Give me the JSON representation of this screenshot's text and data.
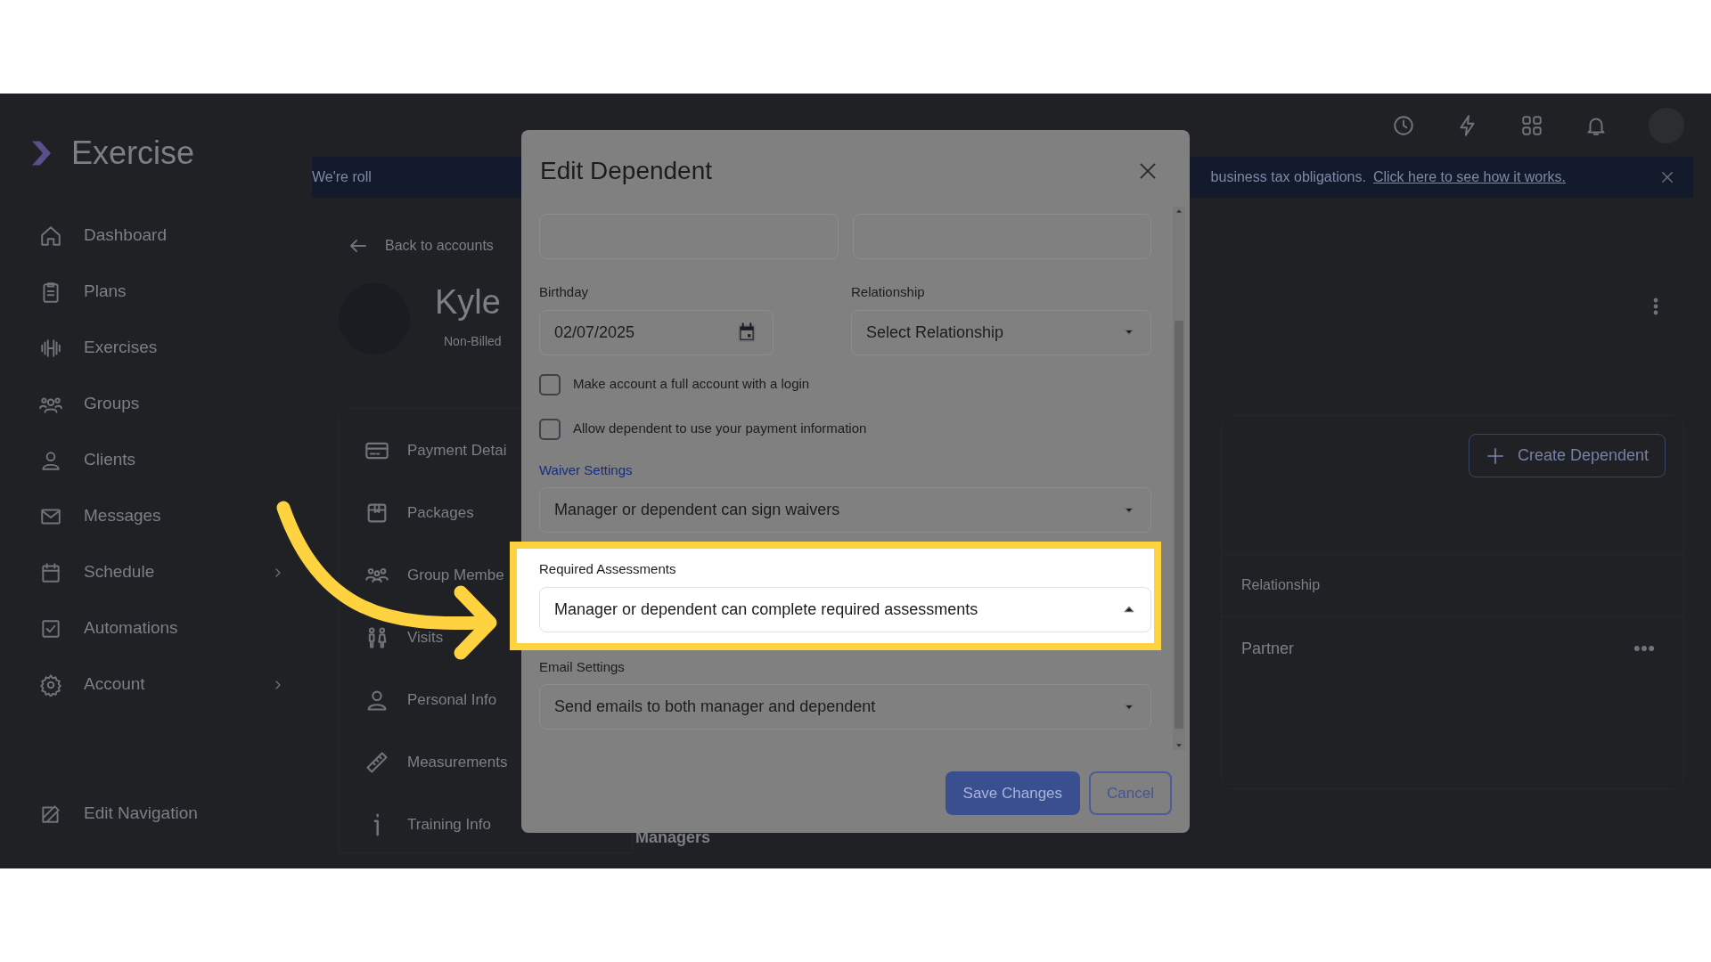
{
  "app": {
    "logo": "Exercise"
  },
  "sidebar": {
    "items": [
      {
        "label": "Dashboard",
        "has_submenu": false
      },
      {
        "label": "Plans",
        "has_submenu": false
      },
      {
        "label": "Exercises",
        "has_submenu": false
      },
      {
        "label": "Groups",
        "has_submenu": false
      },
      {
        "label": "Clients",
        "has_submenu": false
      },
      {
        "label": "Messages",
        "has_submenu": false
      },
      {
        "label": "Schedule",
        "has_submenu": true
      },
      {
        "label": "Automations",
        "has_submenu": false
      },
      {
        "label": "Account",
        "has_submenu": true
      }
    ],
    "footer": {
      "label": "Edit Navigation"
    }
  },
  "banner": {
    "text_left": "We're roll",
    "text_right": "business tax obligations.",
    "link": "Click here to see how it works."
  },
  "profile": {
    "back": "Back to accounts",
    "name": "Kyle",
    "badge": "Non-Billed"
  },
  "profile_menu": [
    {
      "label": "Payment Detai"
    },
    {
      "label": "Packages"
    },
    {
      "label": "Group Membe"
    },
    {
      "label": "Visits"
    },
    {
      "label": "Personal Info"
    },
    {
      "label": "Measurements"
    },
    {
      "label": "Training Info"
    }
  ],
  "dependents": {
    "create_button": "Create Dependent",
    "columns": [
      "Relationship"
    ],
    "rows": [
      [
        "Partner"
      ]
    ],
    "section": "Managers"
  },
  "modal": {
    "title": "Edit Dependent",
    "name_fields": [
      {
        "kind": "text"
      },
      {
        "kind": "text"
      }
    ],
    "birthday": {
      "label": "Birthday",
      "value": "02/07/2025"
    },
    "relationship": {
      "label": "Relationship",
      "value": "Select Relationship",
      "expanded": false
    },
    "checkboxes": [
      {
        "label": "Make account a full account with a login",
        "checked": false
      },
      {
        "label": "Allow dependent to use your payment information",
        "checked": false
      }
    ],
    "selects": [
      {
        "label": "Waiver Settings",
        "kind": "link",
        "value": "Manager or dependent can sign waivers",
        "expanded": false,
        "highlighted": false
      },
      {
        "label": "Required Assessments",
        "kind": "plain",
        "value": "Manager or dependent can complete required assessments",
        "expanded": true,
        "highlighted": true
      },
      {
        "label": "Email Settings",
        "kind": "plain",
        "value": "Send emails to both manager and dependent",
        "expanded": false,
        "highlighted": false
      }
    ],
    "buttons": [
      {
        "label": "Save Changes",
        "kind": "primary"
      },
      {
        "label": "Cancel",
        "kind": "outline"
      }
    ]
  }
}
